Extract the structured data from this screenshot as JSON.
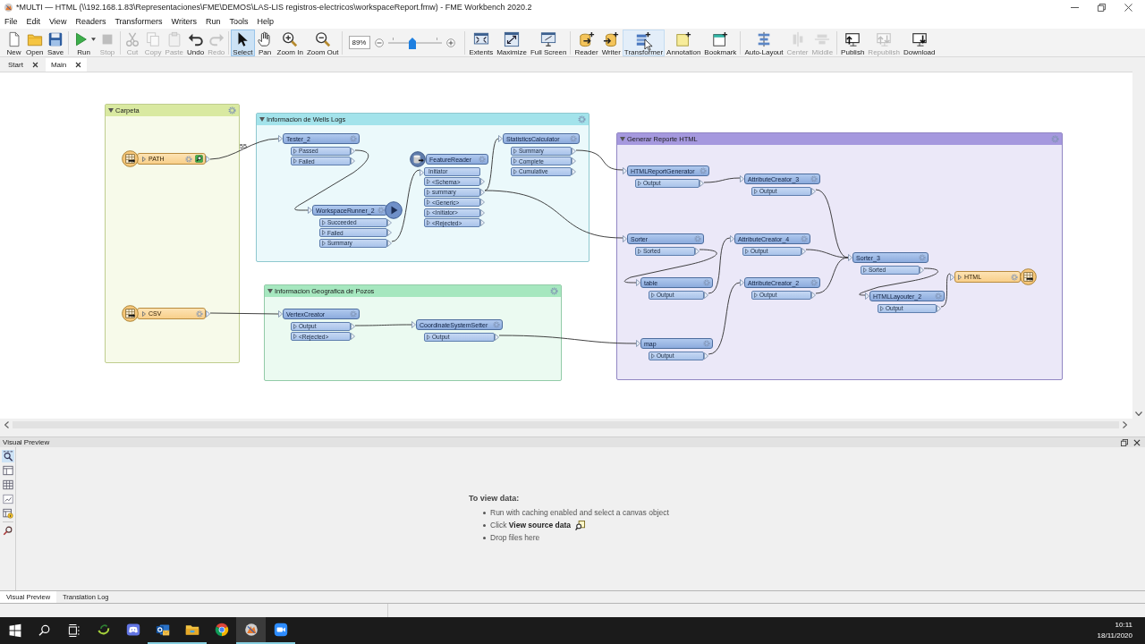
{
  "window": {
    "title": "*MULTI — HTML (\\\\192.168.1.83\\Representaciones\\FME\\DEMOS\\LAS-LIS registros-electricos\\workspaceReport.fmw) - FME Workbench 2020.2"
  },
  "menu": [
    "File",
    "Edit",
    "View",
    "Readers",
    "Transformers",
    "Writers",
    "Run",
    "Tools",
    "Help"
  ],
  "toolbar": [
    {
      "kind": "buttons",
      "items": [
        {
          "label": "New",
          "disabled": false,
          "selected": false,
          "hovered": false
        },
        {
          "label": "Open",
          "disabled": false,
          "selected": false,
          "hovered": false
        },
        {
          "label": "Save",
          "disabled": false,
          "selected": false,
          "hovered": false
        }
      ]
    },
    {
      "kind": "buttons",
      "items": [
        {
          "label": "Run",
          "disabled": false,
          "selected": false,
          "hovered": false,
          "dropdown": true
        },
        {
          "label": "Stop",
          "disabled": true,
          "selected": false,
          "hovered": false
        }
      ]
    },
    {
      "kind": "buttons",
      "items": [
        {
          "label": "Cut",
          "disabled": true,
          "selected": false,
          "hovered": false
        },
        {
          "label": "Copy",
          "disabled": true,
          "selected": false,
          "hovered": false
        },
        {
          "label": "Paste",
          "disabled": true,
          "selected": false,
          "hovered": false
        },
        {
          "label": "Undo",
          "disabled": false,
          "selected": false,
          "hovered": false
        },
        {
          "label": "Redo",
          "disabled": true,
          "selected": false,
          "hovered": false
        }
      ]
    },
    {
      "kind": "buttons",
      "items": [
        {
          "label": "Select",
          "disabled": false,
          "selected": true,
          "hovered": false
        },
        {
          "label": "Pan",
          "disabled": false,
          "selected": false,
          "hovered": false
        },
        {
          "label": "Zoom In",
          "disabled": false,
          "selected": false,
          "hovered": false
        },
        {
          "label": "Zoom Out",
          "disabled": false,
          "selected": false,
          "hovered": false
        }
      ]
    },
    {
      "kind": "zoom",
      "value": "89%",
      "level": 0.45
    },
    {
      "kind": "buttons",
      "items": [
        {
          "label": "Extents",
          "disabled": false,
          "selected": false,
          "hovered": false
        },
        {
          "label": "Maximize",
          "disabled": false,
          "selected": false,
          "hovered": false
        },
        {
          "label": "Full Screen",
          "disabled": false,
          "selected": false,
          "hovered": false
        }
      ]
    },
    {
      "kind": "buttons",
      "items": [
        {
          "label": "Reader",
          "disabled": false,
          "selected": false,
          "hovered": false
        },
        {
          "label": "Writer",
          "disabled": false,
          "selected": false,
          "hovered": false
        },
        {
          "label": "Transformer",
          "disabled": false,
          "selected": false,
          "hovered": true
        },
        {
          "label": "Annotation",
          "disabled": false,
          "selected": false,
          "hovered": false
        },
        {
          "label": "Bookmark",
          "disabled": false,
          "selected": false,
          "hovered": false
        }
      ]
    },
    {
      "kind": "buttons",
      "items": [
        {
          "label": "Auto-Layout",
          "disabled": false,
          "selected": false,
          "hovered": false
        },
        {
          "label": "Center",
          "disabled": true,
          "selected": false,
          "hovered": false
        },
        {
          "label": "Middle",
          "disabled": true,
          "selected": false,
          "hovered": false
        }
      ]
    },
    {
      "kind": "buttons",
      "items": [
        {
          "label": "Publish",
          "disabled": false,
          "selected": false,
          "hovered": false
        },
        {
          "label": "Republish",
          "disabled": true,
          "selected": false,
          "hovered": false
        },
        {
          "label": "Download",
          "disabled": false,
          "selected": false,
          "hovered": false
        }
      ]
    }
  ],
  "tabs": [
    {
      "label": "Start",
      "selected": false
    },
    {
      "label": "Main",
      "selected": true
    }
  ],
  "canvas": {
    "bookmarks": [
      {
        "title": "Carpeta",
        "color": "#d9e9a1",
        "nodes": [
          {
            "kind": "reader",
            "name": "PATH",
            "count": "55"
          },
          {
            "kind": "reader",
            "name": "CSV"
          }
        ]
      },
      {
        "title": "Informacion de Wells Logs",
        "color": "#a3e3eb",
        "nodes": [
          {
            "kind": "transformer",
            "name": "Tester_2",
            "ports": [
              "Passed",
              "Failed"
            ]
          },
          {
            "kind": "transformer",
            "name": "WorkspaceRunner_2",
            "ports": [
              "Succeeded",
              "Failed",
              "Summary"
            ]
          },
          {
            "kind": "transformer",
            "name": "FeatureReader",
            "input_port": "Initiator",
            "ports": [
              "<Schema>",
              "summary",
              "<Generic>",
              "<Initiator>",
              "<Rejected>"
            ]
          },
          {
            "kind": "transformer",
            "name": "StatisticsCalculator",
            "ports": [
              "Summary",
              "Complete",
              "Cumulative"
            ]
          }
        ]
      },
      {
        "title": "Informacion Geografica de Pozos",
        "color": "#a6e7bf",
        "nodes": [
          {
            "kind": "transformer",
            "name": "VertexCreator",
            "ports": [
              "Output",
              "<Rejected>"
            ]
          },
          {
            "kind": "transformer",
            "name": "CoordinateSystemSetter",
            "ports": [
              "Output"
            ]
          }
        ]
      },
      {
        "title": "Generar Reporte HTML",
        "color": "#a598de",
        "nodes": [
          {
            "kind": "transformer",
            "name": "HTMLReportGenerator",
            "ports": [
              "Output"
            ]
          },
          {
            "kind": "transformer",
            "name": "AttributeCreator_3",
            "ports": [
              "Output"
            ]
          },
          {
            "kind": "transformer",
            "name": "Sorter",
            "ports": [
              "Sorted"
            ]
          },
          {
            "kind": "transformer",
            "name": "table",
            "ports": [
              "Output"
            ]
          },
          {
            "kind": "transformer",
            "name": "AttributeCreator_4",
            "ports": [
              "Output"
            ]
          },
          {
            "kind": "transformer",
            "name": "AttributeCreator_2",
            "ports": [
              "Output"
            ]
          },
          {
            "kind": "transformer",
            "name": "map",
            "ports": [
              "Output"
            ]
          },
          {
            "kind": "transformer",
            "name": "Sorter_3",
            "ports": [
              "Sorted"
            ]
          },
          {
            "kind": "transformer",
            "name": "HTMLLayouter_2",
            "ports": [
              "Output"
            ]
          },
          {
            "kind": "writer",
            "name": "HTML"
          }
        ]
      }
    ]
  },
  "preview": {
    "title": "Visual Preview",
    "tools": [
      {
        "selected": true
      },
      {
        "selected": false
      },
      {
        "selected": false
      },
      {
        "selected": false
      },
      {
        "selected": false
      },
      {
        "selected": false
      }
    ],
    "heading": "To view data:",
    "hints": [
      "Run with caching enabled and select a canvas object",
      "Click **View source data**",
      "Drop files here"
    ]
  },
  "bottom_tabs": [
    {
      "label": "Visual Preview",
      "selected": true
    },
    {
      "label": "Translation Log",
      "selected": false
    }
  ],
  "taskbar": {
    "apps": [
      {
        "running": false,
        "selected": false
      },
      {
        "running": false,
        "selected": false
      },
      {
        "running": true,
        "selected": false
      },
      {
        "running": true,
        "selected": false
      },
      {
        "running": false,
        "selected": false
      },
      {
        "running": true,
        "selected": true
      },
      {
        "running": true,
        "selected": false
      }
    ],
    "time": "10:11",
    "date": "18/11/2020"
  }
}
